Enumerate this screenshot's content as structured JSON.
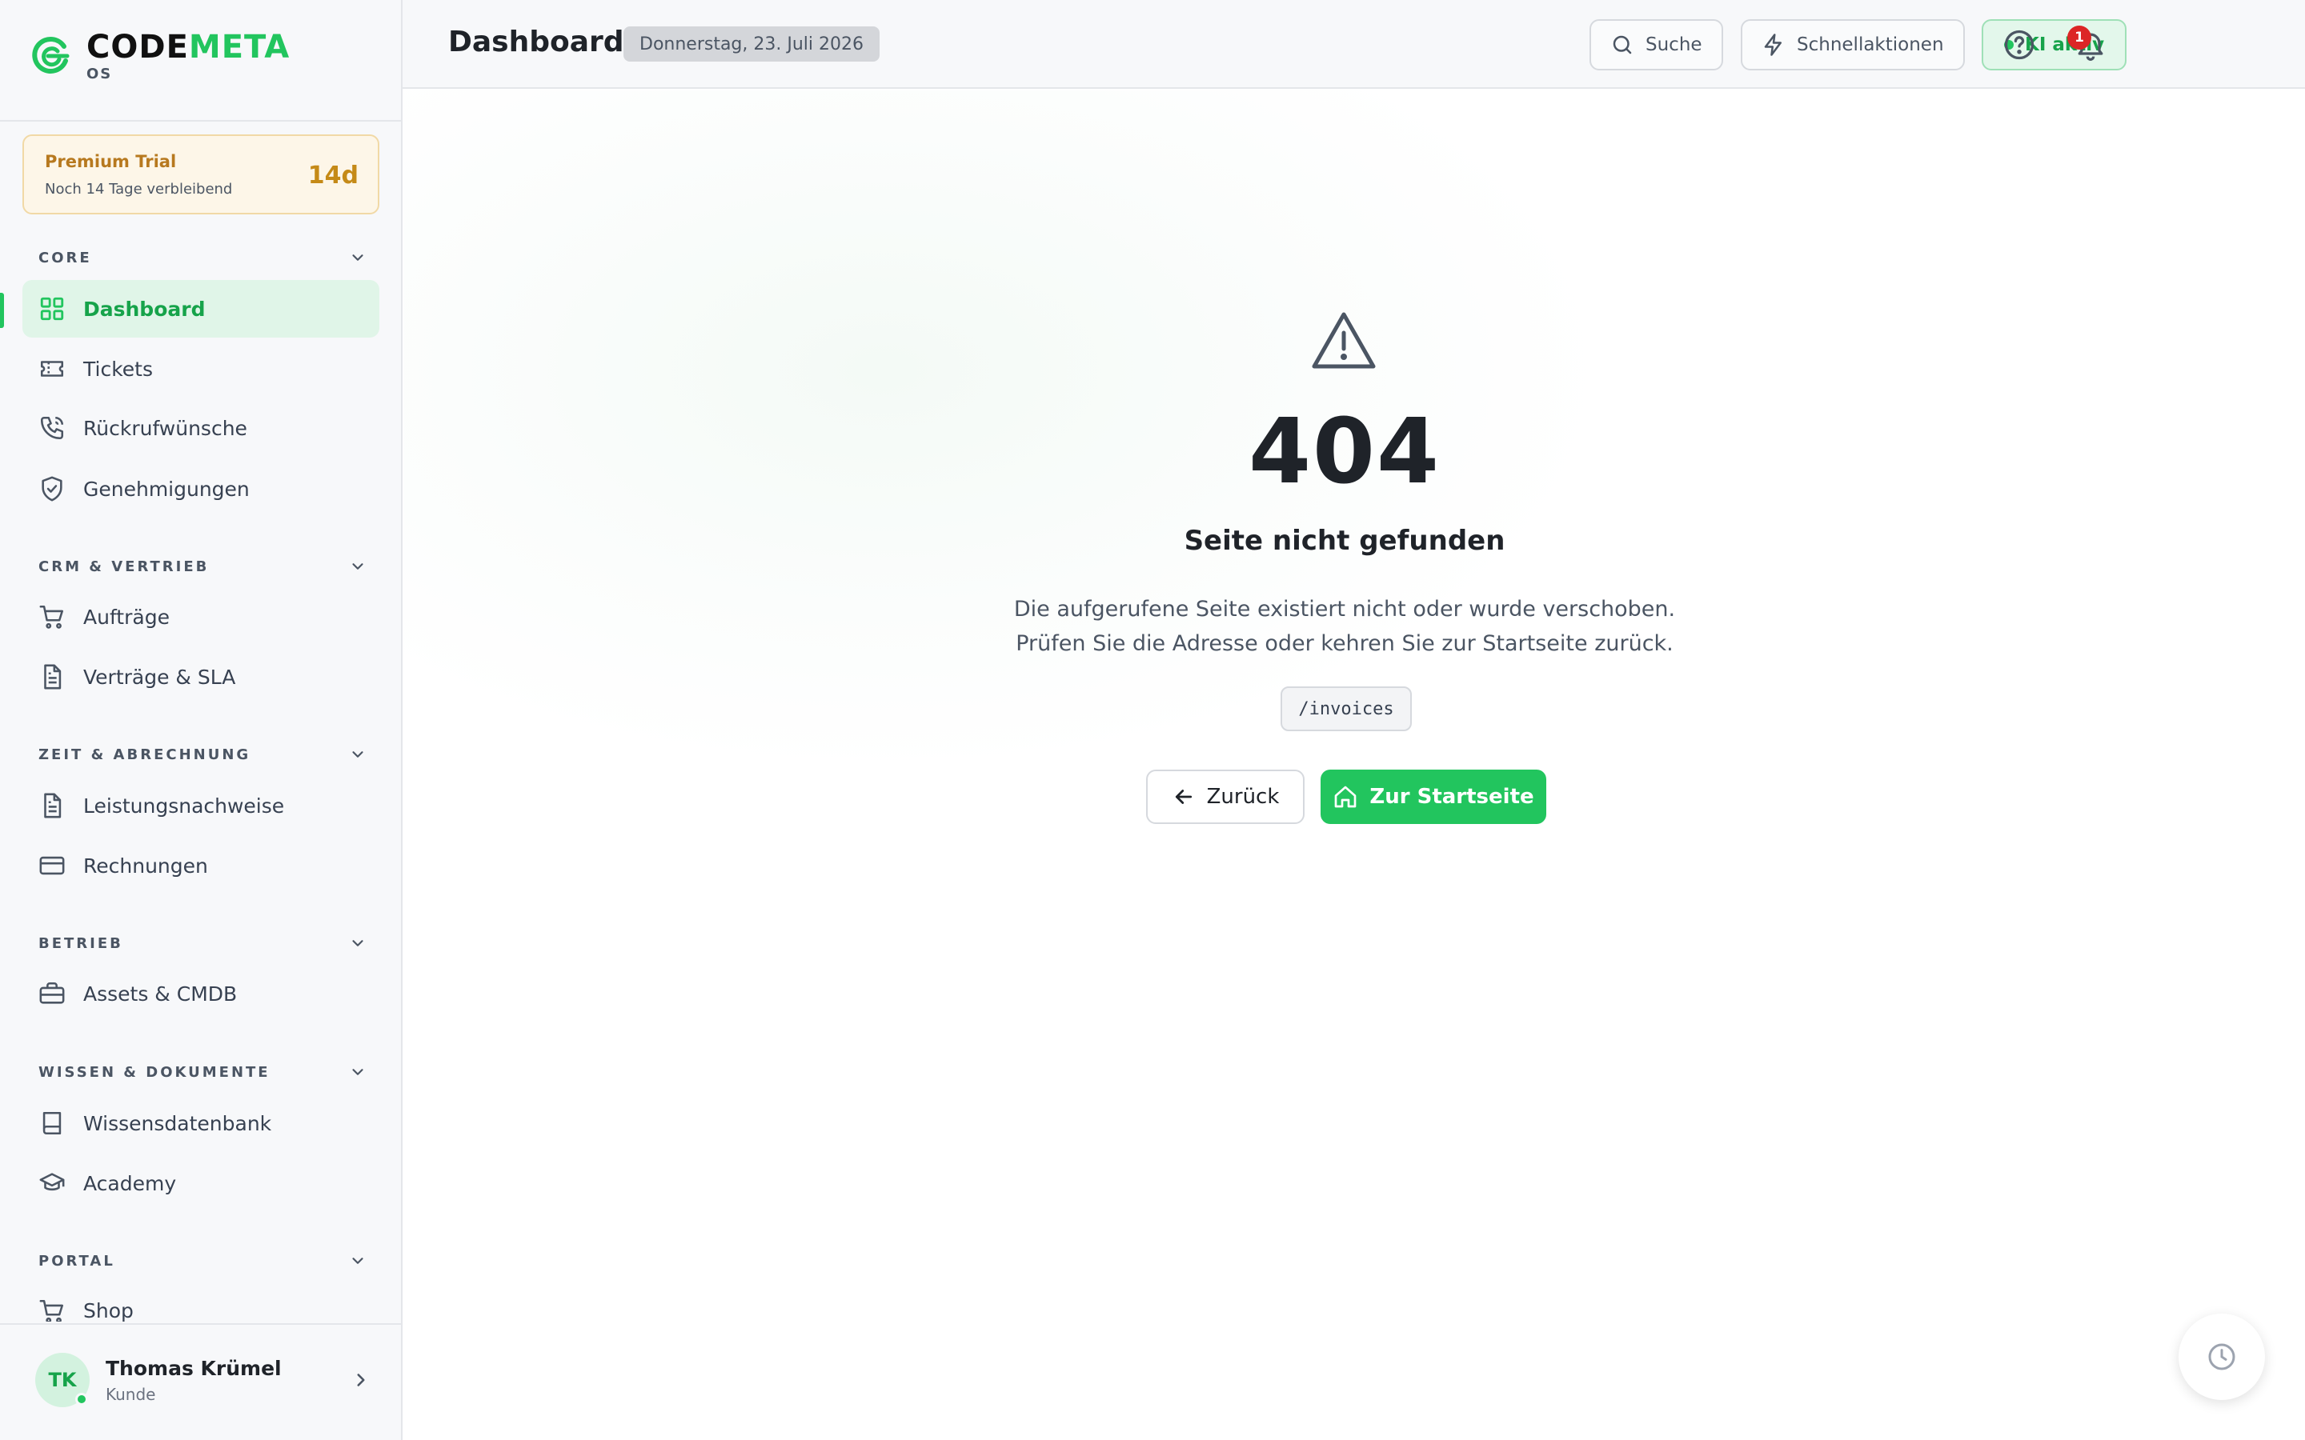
{
  "brand": {
    "name_part1": "CODE",
    "name_part2": "META",
    "sub": "OS"
  },
  "trial": {
    "title": "Premium Trial",
    "subtitle": "Noch 14 Tage verbleibend",
    "days": "14d"
  },
  "sidebar": {
    "sections": [
      {
        "label": "CORE"
      },
      {
        "label": "CRM & VERTRIEB"
      },
      {
        "label": "ZEIT & ABRECHNUNG"
      },
      {
        "label": "BETRIEB"
      },
      {
        "label": "WISSEN & DOKUMENTE"
      },
      {
        "label": "PORTAL"
      }
    ],
    "items": [
      {
        "label": "Dashboard",
        "icon": "grid-icon",
        "active": true
      },
      {
        "label": "Tickets",
        "icon": "ticket-icon"
      },
      {
        "label": "Rückrufwünsche",
        "icon": "phone-icon"
      },
      {
        "label": "Genehmigungen",
        "icon": "shield-check-icon"
      },
      {
        "label": "Aufträge",
        "icon": "cart-icon"
      },
      {
        "label": "Verträge & SLA",
        "icon": "document-icon"
      },
      {
        "label": "Leistungsnachweise",
        "icon": "document-icon"
      },
      {
        "label": "Rechnungen",
        "icon": "credit-card-icon"
      },
      {
        "label": "Assets & CMDB",
        "icon": "briefcase-icon"
      },
      {
        "label": "Wissensdatenbank",
        "icon": "book-icon"
      },
      {
        "label": "Academy",
        "icon": "graduation-cap-icon"
      },
      {
        "label": "Shop",
        "icon": "cart-icon"
      }
    ]
  },
  "user": {
    "initials": "TK",
    "name": "Thomas Krümel",
    "role": "Kunde"
  },
  "header": {
    "title": "Dashboard",
    "date": "Donnerstag, 23. Juli 2026",
    "search_label": "Suche",
    "quick_actions_label": "Schnellaktionen",
    "ai_status_label": "KI aktiv",
    "notification_count": "1"
  },
  "error": {
    "code": "404",
    "title": "Seite nicht gefunden",
    "description": "Die aufgerufene Seite existiert nicht oder wurde verschoben. Prüfen Sie die Adresse oder kehren Sie zur Startseite zurück.",
    "path": "/invoices",
    "back_label": "Zurück",
    "home_label": "Zur Startseite"
  },
  "colors": {
    "accent": "#22c55e",
    "trial": "#c58a17",
    "badge": "#dc2626"
  }
}
